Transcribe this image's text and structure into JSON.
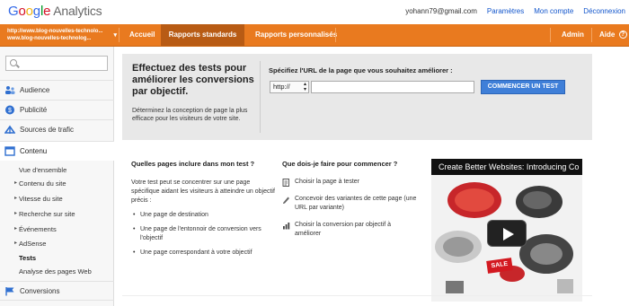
{
  "logo": {
    "brand": "Google",
    "product": "Analytics"
  },
  "top_links": {
    "email": "yohann79@gmail.com",
    "settings": "Paramètres",
    "account": "Mon compte",
    "logout": "Déconnexion"
  },
  "account_selector": {
    "line1": "http://www.blog-nouvelles-technolo...",
    "line2": "www.blog-nouvelles-technolog..."
  },
  "nav": {
    "home": "Accueil",
    "standard": "Rapports standards",
    "custom": "Rapports personnalisés",
    "admin": "Admin",
    "help": "Aide",
    "help_icon": "?"
  },
  "sidebar": {
    "search_placeholder": "",
    "sections": [
      {
        "label": "Audience",
        "icon": "people-icon"
      },
      {
        "label": "Publicité",
        "icon": "ads-icon"
      },
      {
        "label": "Sources de trafic",
        "icon": "traffic-icon"
      },
      {
        "label": "Contenu",
        "icon": "content-icon"
      }
    ],
    "content_items": [
      "Vue d'ensemble",
      "Contenu du site",
      "Vitesse du site",
      "Recherche sur site",
      "Événements",
      "AdSense",
      "Tests",
      "Analyse des pages Web"
    ],
    "conversions": "Conversions"
  },
  "hero": {
    "title": "Effectuez des tests pour améliorer les conversions par objectif.",
    "description": "Déterminez la conception de page la plus efficace pour les visiteurs de votre site.",
    "url_label": "Spécifiez l'URL de la page que vous souhaitez améliorer :",
    "protocol": "http://",
    "url_value": "",
    "start_button": "COMMENCER UN TEST"
  },
  "which_pages": {
    "title": "Quelles pages inclure dans mon test ?",
    "para": "Votre test peut se concentrer sur une page spécifique aidant les visiteurs à atteindre un objectif précis :",
    "items": [
      "Une page de destination",
      "Une page de l'entonnoir de conversion vers l'objectif",
      "Une page correspondant à votre objectif"
    ]
  },
  "what_to_do": {
    "title": "Que dois-je faire pour commencer ?",
    "steps": [
      "Choisir la page à tester",
      "Concevoir des variantes de cette page (une URL par variante)",
      "Choisir la conversion par objectif à améliorer"
    ]
  },
  "video": {
    "title": "Create Better Websites: Introducing Co",
    "sale": "SALE"
  },
  "colors": {
    "nav_orange": "#e97a1f",
    "nav_active": "#b85b14",
    "button_blue": "#3f7fd8",
    "link_blue": "#1155cc"
  }
}
